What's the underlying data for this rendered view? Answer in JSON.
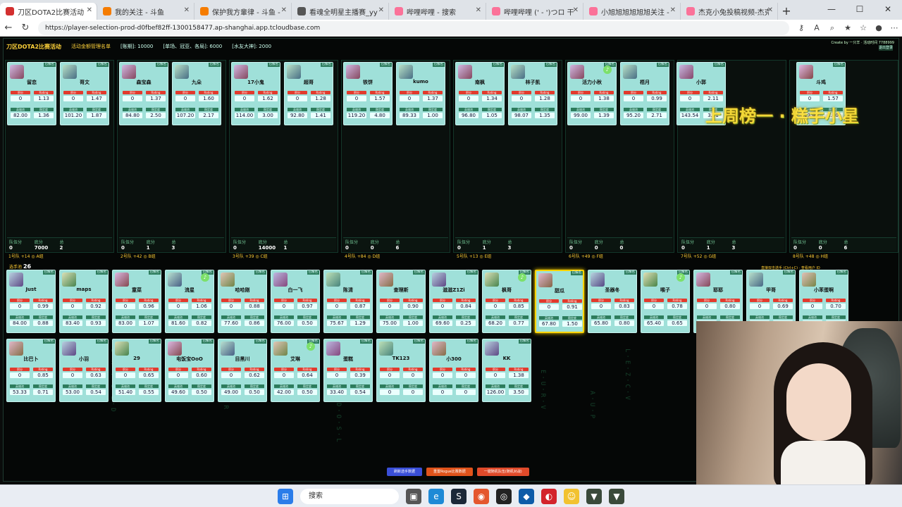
{
  "browser": {
    "tabs": [
      {
        "title": "刀区DOTA2比赛活动",
        "active": true
      },
      {
        "title": "我的关注 - 斗鱼"
      },
      {
        "title": "保护我方輩律 - 斗鱼 - 看见..."
      },
      {
        "title": "看魂全明星主播赛_yy"
      },
      {
        "title": "哔哩哔哩 - 搜索"
      },
      {
        "title": "哔哩哔哩 (' - ')つロ 干杯~"
      },
      {
        "title": "小旭旭旭旭旭旭关注 - 小旭旭"
      },
      {
        "title": "杰克小兔投稿视频-杰克小兔"
      }
    ],
    "new_tab": "+",
    "url": "https://player-selection-prod-d0fbef82ff-1300158477.ap-shanghai.app.tcloudbase.com"
  },
  "app": {
    "title": "刀区DOTA2比赛活动",
    "stats": [
      "活动金额管理名单",
      "[账期]: 10000",
      "[单场、冠亚、各局]: 6000",
      "[水友大神]: 2000"
    ],
    "credit": "Create by 一只羊 · 活动时间 7788999",
    "reset_label": "退出登录",
    "banner": "上周榜一 · 糕手小星",
    "pool_title": "选手池",
    "pool_count": "26",
    "pool_hint": "直接双击选手 (Ctrl+C) · 查看用户 ID"
  },
  "labels": {
    "points": "积分",
    "rating": "Rating",
    "hero_pool": "英雄池",
    "stability": "稳定度"
  },
  "teams": [
    {
      "name": "1号队",
      "extra": "+14 ◎ A组",
      "foot": [
        {
          "k": "队伍分",
          "v": "0"
        },
        {
          "k": "底分",
          "v": "7000"
        },
        {
          "k": "总",
          "v": "2"
        },
        {
          "k": "",
          "v": ""
        }
      ],
      "players": [
        {
          "name": "留恋",
          "pts": "0",
          "rating": "1.13",
          "a": "82.00",
          "b": "1.36"
        },
        {
          "name": "哥文",
          "pts": "0",
          "rating": "1.47",
          "a": "101.20",
          "b": "1.87"
        }
      ]
    },
    {
      "name": "2号队",
      "extra": "+42 ◎ B组",
      "foot": [
        {
          "k": "队伍分",
          "v": "0"
        },
        {
          "k": "底分",
          "v": "1"
        },
        {
          "k": "总",
          "v": "3"
        },
        {
          "k": "",
          "v": ""
        }
      ],
      "players": [
        {
          "name": "森宝森",
          "pts": "0",
          "rating": "1.37",
          "a": "84.80",
          "b": "2.50"
        },
        {
          "name": "九朵",
          "pts": "0",
          "rating": "1.60",
          "a": "107.20",
          "b": "2.17"
        }
      ]
    },
    {
      "name": "3号队",
      "extra": "+39 ◎ C组",
      "foot": [
        {
          "k": "队伍分",
          "v": "0"
        },
        {
          "k": "底分",
          "v": "14000"
        },
        {
          "k": "总",
          "v": "1"
        },
        {
          "k": "",
          "v": ""
        }
      ],
      "players": [
        {
          "name": "17小鬼",
          "pts": "0",
          "rating": "1.62",
          "a": "114.00",
          "b": "3.00"
        },
        {
          "name": "超哥",
          "pts": "0",
          "rating": "1.28",
          "a": "92.80",
          "b": "1.41"
        }
      ]
    },
    {
      "name": "4号队",
      "extra": "+84 ◎ D组",
      "foot": [
        {
          "k": "队伍分",
          "v": "0"
        },
        {
          "k": "底分",
          "v": "0"
        },
        {
          "k": "总",
          "v": "6"
        },
        {
          "k": "",
          "v": ""
        }
      ],
      "players": [
        {
          "name": "铁饼",
          "pts": "0",
          "rating": "1.57",
          "a": "119.20",
          "b": "4.80"
        },
        {
          "name": "kumo",
          "pts": "0",
          "rating": "1.37",
          "a": "89.33",
          "b": "1.00"
        }
      ]
    },
    {
      "name": "5号队",
      "extra": "+13 ◎ E组",
      "foot": [
        {
          "k": "队伍分",
          "v": "0"
        },
        {
          "k": "底分",
          "v": "1"
        },
        {
          "k": "总",
          "v": "3"
        },
        {
          "k": "",
          "v": ""
        }
      ],
      "players": [
        {
          "name": "南枫",
          "pts": "0",
          "rating": "1.34",
          "a": "96.80",
          "b": "1.05"
        },
        {
          "name": "林子凯",
          "pts": "0",
          "rating": "1.28",
          "a": "98.07",
          "b": "1.35"
        }
      ]
    },
    {
      "name": "6号队",
      "extra": "+49 ◎ F组",
      "foot": [
        {
          "k": "队伍分",
          "v": "0"
        },
        {
          "k": "底分",
          "v": "0"
        },
        {
          "k": "总",
          "v": "0"
        },
        {
          "k": "",
          "v": ""
        }
      ],
      "players": [
        {
          "name": "活力小秋",
          "pts": "0",
          "rating": "1.38",
          "a": "99.00",
          "b": "1.39",
          "speaking": true
        },
        {
          "name": "梧月",
          "pts": "0",
          "rating": "0.99",
          "a": "95.20",
          "b": "2.71"
        }
      ]
    },
    {
      "name": "7号队",
      "extra": "+52 ◎ G组",
      "foot": [
        {
          "k": "队伍分",
          "v": "0"
        },
        {
          "k": "底分",
          "v": "1"
        },
        {
          "k": "总",
          "v": "3"
        },
        {
          "k": "",
          "v": ""
        }
      ],
      "players": [
        {
          "name": "小郭",
          "pts": "0",
          "rating": "2.11",
          "a": "143.54",
          "b": "3.11"
        }
      ]
    },
    {
      "name": "8号队",
      "extra": "+48 ◎ H组",
      "foot": [
        {
          "k": "队伍分",
          "v": "0"
        },
        {
          "k": "底分",
          "v": "0"
        },
        {
          "k": "总",
          "v": "6"
        },
        {
          "k": "",
          "v": ""
        }
      ],
      "players": [
        {
          "name": "斗鸡",
          "pts": "0",
          "rating": "1.57",
          "a": "113.40",
          "b": "1.80"
        }
      ]
    }
  ],
  "pool": [
    {
      "name": "Just",
      "pts": "0",
      "rating": "0.99",
      "a": "84.00",
      "b": "0.88"
    },
    {
      "name": "maps",
      "pts": "0",
      "rating": "0.92",
      "a": "83.40",
      "b": "0.93"
    },
    {
      "name": "童菜",
      "pts": "0",
      "rating": "0.96",
      "a": "83.00",
      "b": "1.07"
    },
    {
      "name": "流星",
      "pts": "0",
      "rating": "1.06",
      "a": "81.60",
      "b": "0.82",
      "speaking": true
    },
    {
      "name": "哈哈刚",
      "pts": "0",
      "rating": "0.88",
      "a": "77.60",
      "b": "0.86"
    },
    {
      "name": "白一飞",
      "pts": "0",
      "rating": "0.97",
      "a": "76.00",
      "b": "0.50"
    },
    {
      "name": "陈清",
      "pts": "0",
      "rating": "0.87",
      "a": "75.67",
      "b": "1.29"
    },
    {
      "name": "查理斯",
      "pts": "0",
      "rating": "0.90",
      "a": "75.00",
      "b": "1.00"
    },
    {
      "name": "滋滋Z1Zi",
      "pts": "0",
      "rating": "0.84",
      "a": "69.60",
      "b": "0.25"
    },
    {
      "name": "枫哥",
      "pts": "0",
      "rating": "0.85",
      "a": "68.20",
      "b": "0.77",
      "speaking": true
    },
    {
      "name": "甜瓜",
      "pts": "0",
      "rating": "0.91",
      "a": "67.80",
      "b": "1.50",
      "selected": true
    },
    {
      "name": "圣器冬",
      "pts": "0",
      "rating": "0.83",
      "a": "65.80",
      "b": "0.80"
    },
    {
      "name": "喉子",
      "pts": "0",
      "rating": "0.78",
      "a": "65.40",
      "b": "0.65",
      "speaking": true
    },
    {
      "name": "耶耶",
      "pts": "0",
      "rating": "0.80",
      "a": "62.60",
      "b": "0.70"
    },
    {
      "name": "甲哥",
      "pts": "0",
      "rating": "0.69",
      "a": "58.40",
      "b": "0.60"
    },
    {
      "name": "小苯蛋啊",
      "pts": "0",
      "rating": "0.70",
      "a": "55.20",
      "b": "0.80"
    },
    {
      "name": "比巴卜",
      "pts": "0",
      "rating": "0.85",
      "a": "53.33",
      "b": "0.71"
    },
    {
      "name": "小羽",
      "pts": "0",
      "rating": "0.63",
      "a": "53.00",
      "b": "0.54"
    },
    {
      "name": "29",
      "pts": "0",
      "rating": "0.65",
      "a": "51.40",
      "b": "0.55"
    },
    {
      "name": "电饭宝OoO",
      "pts": "0",
      "rating": "0.60",
      "a": "49.60",
      "b": "0.50"
    },
    {
      "name": "目黑川",
      "pts": "0",
      "rating": "0.62",
      "a": "49.00",
      "b": "0.50"
    },
    {
      "name": "艾琳",
      "pts": "0",
      "rating": "0.64",
      "a": "42.00",
      "b": "0.50",
      "speaking": true
    },
    {
      "name": "蛋糕",
      "pts": "0",
      "rating": "0.39",
      "a": "33.40",
      "b": "0.54"
    },
    {
      "name": "TK123",
      "pts": "0",
      "rating": "0",
      "a": "0",
      "b": "0"
    },
    {
      "name": "小300",
      "pts": "0",
      "rating": "0",
      "a": "0",
      "b": "0"
    },
    {
      "name": "KK",
      "pts": "0",
      "rating": "1.38",
      "a": "126.00",
      "b": "3.50"
    }
  ],
  "bottom_buttons": [
    {
      "label": "刷新选手数据",
      "color": "#3a4fd8"
    },
    {
      "label": "重置Rogue比赛数据",
      "color": "#e0531b"
    },
    {
      "label": "一键随机队伍(随机对战)",
      "color": "#e04a2a"
    }
  ],
  "taskbar": {
    "search_placeholder": "搜索"
  }
}
